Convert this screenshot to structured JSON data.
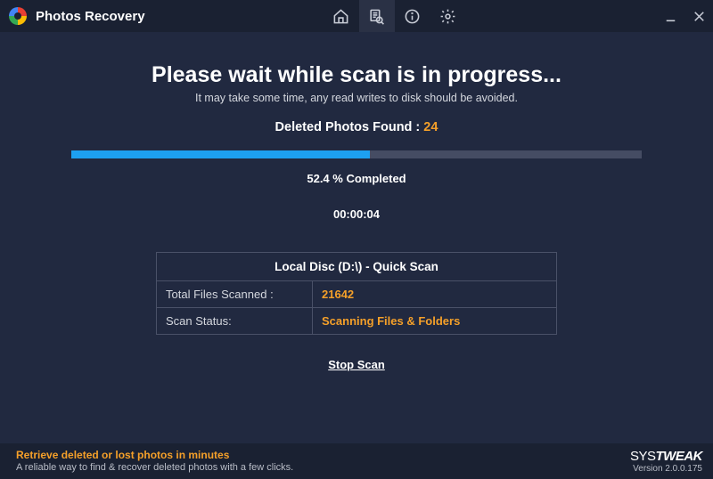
{
  "app": {
    "title": "Photos Recovery"
  },
  "scan": {
    "heading": "Please wait while scan is in progress...",
    "subheading": "It may take some time, any read writes to disk should be avoided.",
    "deleted_label": "Deleted Photos Found :",
    "deleted_value": "24",
    "percent_text": "52.4 % Completed",
    "percent_value": 52.4,
    "elapsed": "00:00:04",
    "details_header": "Local Disc (D:\\) - Quick Scan",
    "row1_label": "Total Files Scanned :",
    "row1_value": "21642",
    "row2_label": "Scan Status:",
    "row2_value": "Scanning Files & Folders",
    "stop_label": "Stop Scan"
  },
  "footer": {
    "title": "Retrieve deleted or lost photos in minutes",
    "sub": "A reliable way to find & recover deleted photos with a few clicks.",
    "brand": "SYSTWEAK",
    "version": "Version 2.0.0.175"
  }
}
